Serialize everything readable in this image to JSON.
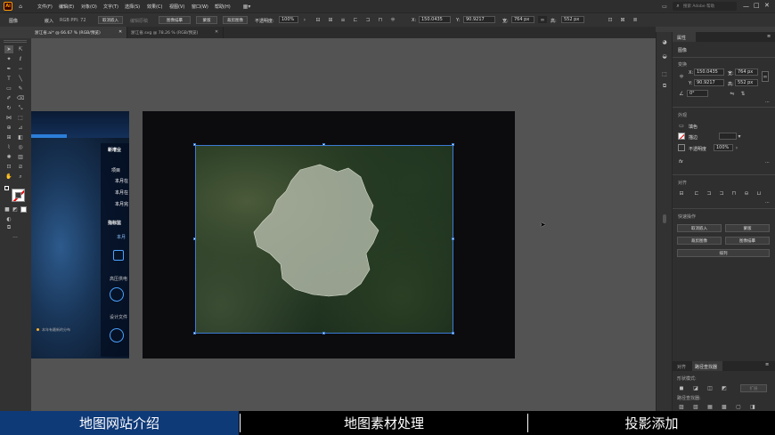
{
  "app": {
    "logo": "Ai"
  },
  "menu": [
    "文件(F)",
    "编辑(E)",
    "对象(O)",
    "文字(T)",
    "选择(S)",
    "效果(C)",
    "视图(V)",
    "窗口(W)",
    "帮助(H)"
  ],
  "search_placeholder": "搜索 Adobe 帮助",
  "control": {
    "type_label": "图像",
    "link_label": "嵌入",
    "info": "RGB  PPI: 72",
    "unembed": "取消嵌入",
    "edit_original": "编辑原稿",
    "image_trace": "图像描摹",
    "mask": "蒙版",
    "crop": "裁剪图像",
    "opacity_label": "不透明度:",
    "opacity_value": "100%",
    "x_label": "X:",
    "x_value": "150.0435",
    "y_label": "Y:",
    "y_value": "90.9217",
    "w_label": "宽:",
    "w_value": "764 px",
    "h_label": "高:",
    "h_value": "552 px"
  },
  "tabs": [
    {
      "label": "浙江省.ai* @ 66.67 % (RGB/预览)"
    },
    {
      "label": "浙江省.svg @ 78.26 % (RGB/预览)"
    }
  ],
  "left_artboard": {
    "labels": [
      "新增业",
      "项目",
      "本月在",
      "本月在",
      "本月完",
      "指标监",
      "本月",
      "高压供电",
      "设计文件"
    ],
    "footer": "本年有最新的分布"
  },
  "properties": {
    "tab": "属性",
    "type": "图像",
    "transform": "变换",
    "x_label": "X:",
    "x_value": "150.0435",
    "y_label": "Y:",
    "y_value": "90.9217",
    "w_label": "宽:",
    "w_value": "764 px",
    "h_label": "高:",
    "h_value": "552 px",
    "angle": "0°",
    "appearance": "外观",
    "fill": "填色",
    "stroke": "描边",
    "opacity_label": "不透明度",
    "opacity_value": "100%",
    "fx": "fx",
    "align": "对齐",
    "quick_actions": "快速操作",
    "qa_unembed": "取消嵌入",
    "qa_mask": "蒙版",
    "qa_crop": "裁剪图像",
    "qa_trace": "图像描摹",
    "qa_arrange": "排列",
    "bottom_tab1": "对齐",
    "bottom_tab2": "路径查找器",
    "shape_modes": "形状模式:",
    "expand": "扩展",
    "pathfinders": "路径查找器:"
  },
  "bottom_bar": {
    "sections": [
      "地图网站介绍",
      "地图素材处理",
      "投影添加"
    ],
    "colors": {
      "active": "#0f3a78",
      "bg": "#000000"
    }
  }
}
